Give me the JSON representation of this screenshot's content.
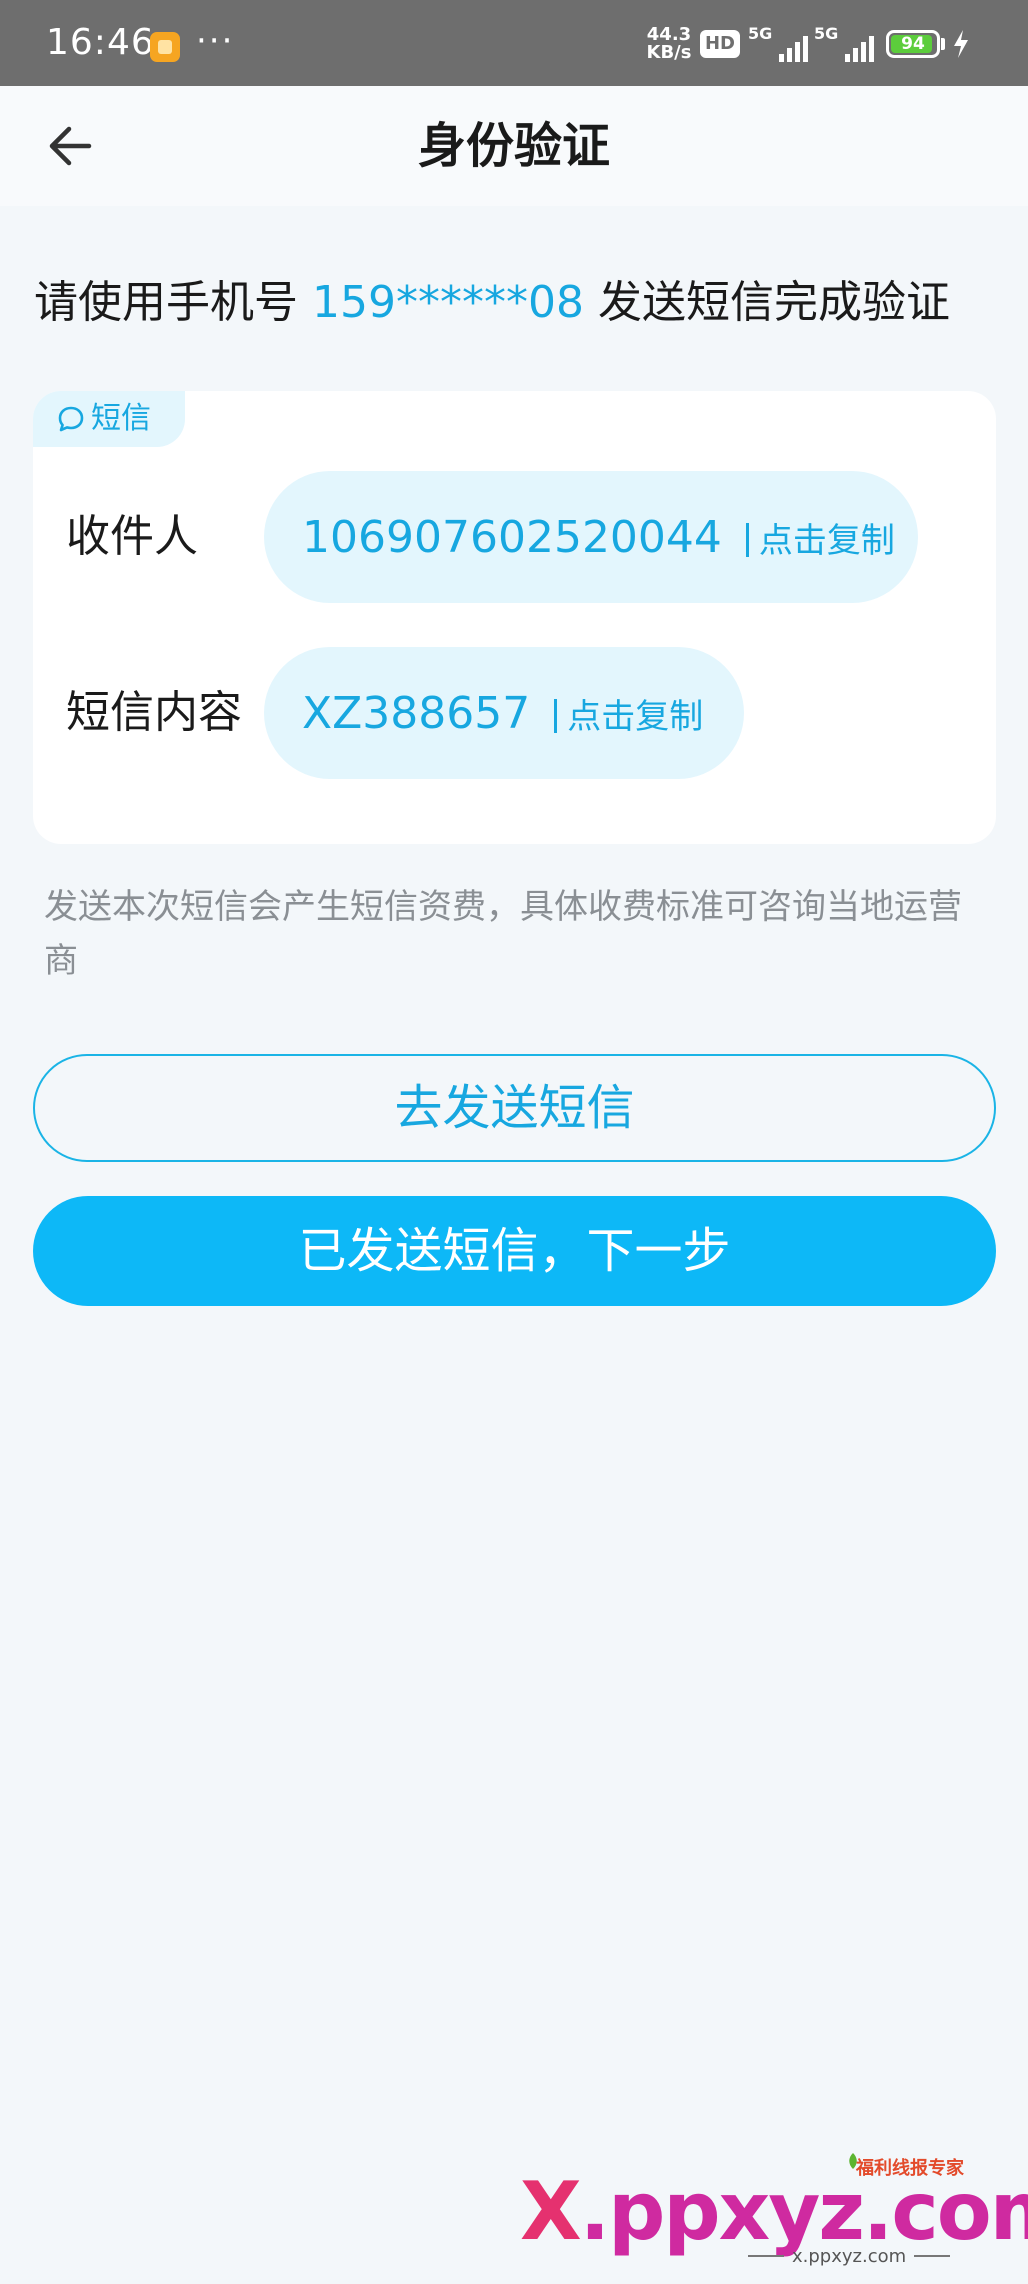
{
  "status_bar": {
    "time": "16:46",
    "more": "···",
    "speed_value": "44.3",
    "speed_unit": "KB/s",
    "hd_badge": "HD",
    "network_1": "5G",
    "network_2": "5G",
    "battery": "94",
    "battery_level_percent": 94
  },
  "header": {
    "title": "身份验证"
  },
  "instruction": {
    "prefix": "请使用手机号",
    "phone": "159******08",
    "suffix": "发送短信完成验证"
  },
  "sms_card": {
    "tag": "短信",
    "recipient": {
      "label": "收件人",
      "value": "106907602520044",
      "copy_label": "点击复制"
    },
    "content": {
      "label": "短信内容",
      "value": "XZ388657",
      "copy_label": "点击复制"
    }
  },
  "notice": "发送本次短信会产生短信资费，具体收费标准可咨询当地运营商",
  "buttons": {
    "send_sms": "去发送短信",
    "next_step": "已发送短信，下一步"
  },
  "watermark": {
    "brand_x": "X",
    "brand_rest": ".ppxyz.com",
    "tagline": "福利线报专家",
    "url": "x.ppxyz.com"
  },
  "colors": {
    "accent": "#17a7e0",
    "primary_button": "#0db8f7",
    "pill_background": "#e3f6fd",
    "page_background": "#f3f7fa"
  }
}
